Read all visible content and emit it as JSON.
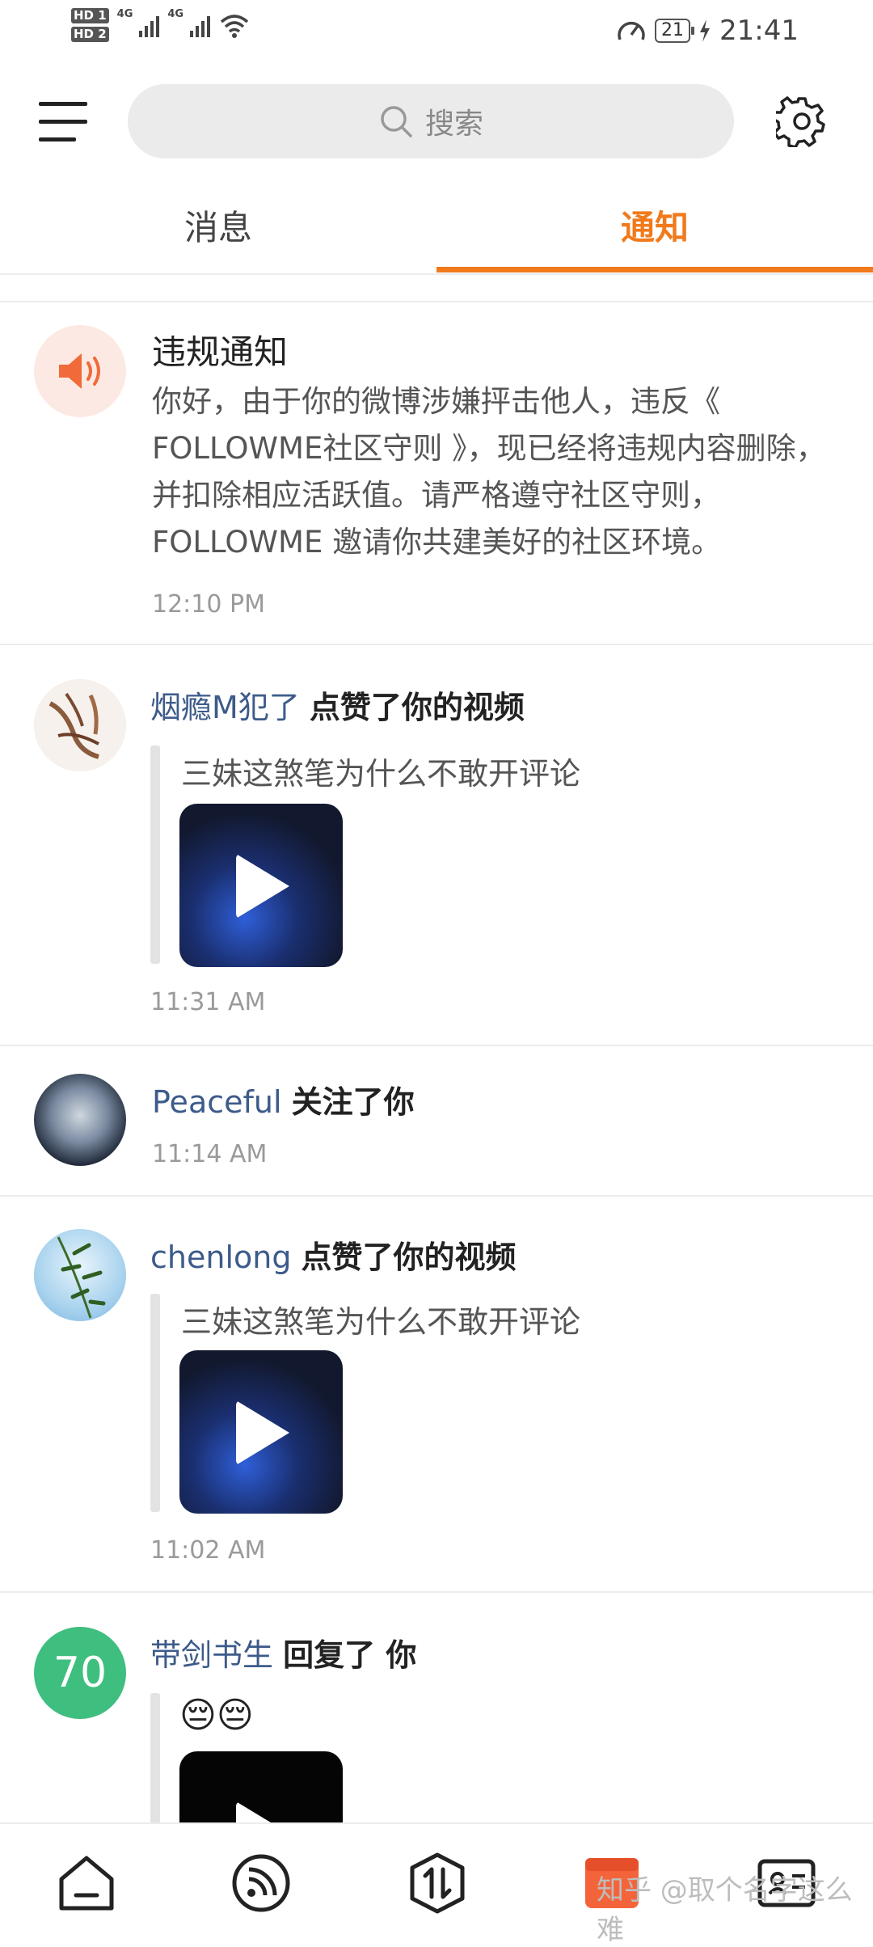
{
  "status_bar": {
    "sim1": "HD 1",
    "sim2": "HD 2",
    "net1": "4G",
    "net2": "4G",
    "battery": "21",
    "time": "21:41"
  },
  "header": {
    "search_placeholder": "搜索"
  },
  "tabs": [
    {
      "label": "消息",
      "active": false
    },
    {
      "label": "通知",
      "active": true
    }
  ],
  "accent_color": "#f07a1c",
  "notifications": {
    "violation": {
      "title": "违规通知",
      "body": "你好，由于你的微博涉嫌抨击他人，违反《 FOLLOWME社区守则 》，现已经将违规内容删除，并扣除相应活跃值。请严格遵守社区守则，FOLLOWME 邀请你共建美好的社区环境。",
      "time": "12:10 PM"
    },
    "like1": {
      "user": "烟瘾M犯了",
      "action": "点赞了你的视频",
      "quote": "三妹这煞笔为什么不敢开评论",
      "time": "11:31 AM"
    },
    "follow": {
      "user": "Peaceful",
      "action": "关注了你",
      "time": "11:14 AM"
    },
    "like2": {
      "user": "chenlong",
      "action": "点赞了你的视频",
      "quote": "三妹这煞笔为什么不敢开评论",
      "time": "11:02 AM"
    },
    "reply": {
      "avatar_text": "70",
      "user": "带剑书生",
      "action": "回复了 你",
      "quote": "😔😔"
    }
  },
  "bottom_nav": {
    "items": [
      "home-icon",
      "feed-icon",
      "trade-icon",
      "notification-icon",
      "profile-card-icon"
    ]
  },
  "watermark": "知乎 @取个名字这么难"
}
